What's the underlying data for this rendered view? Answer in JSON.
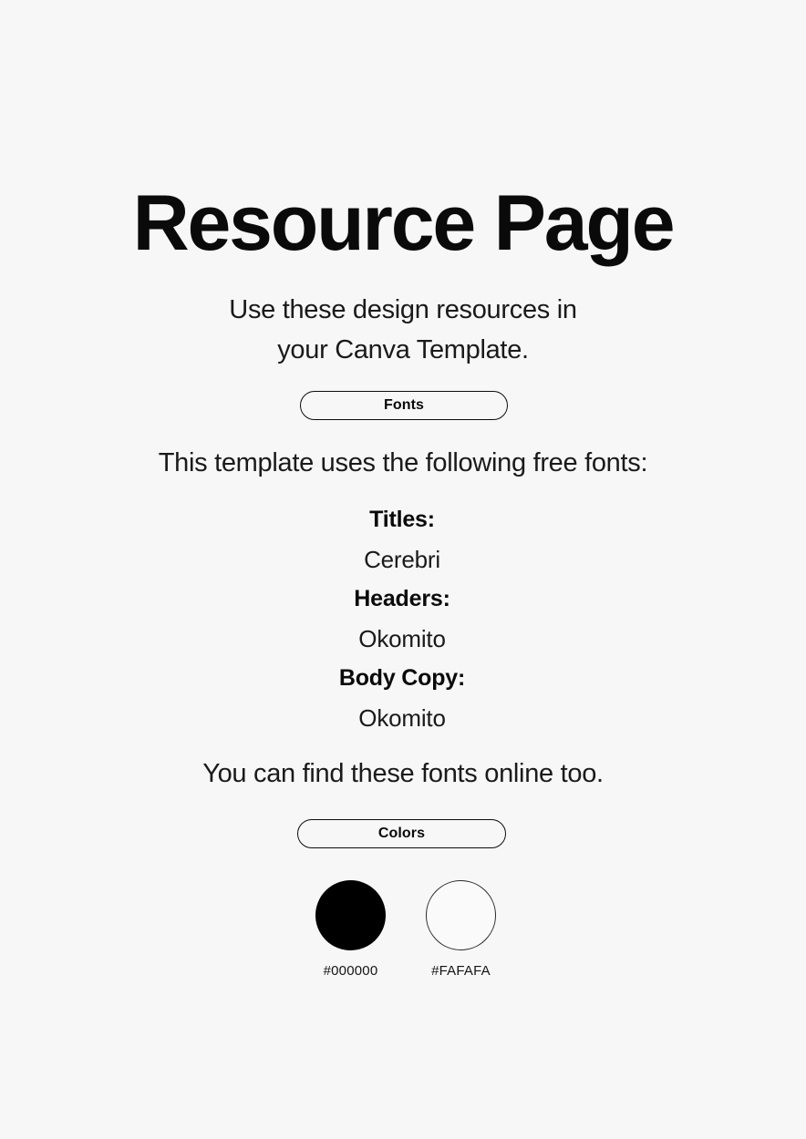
{
  "page": {
    "background_color": "#F7F7F7",
    "title": "Resource Page",
    "subtitle_line_1": "Use these design resources in",
    "subtitle_line_2": "your Canva Template."
  },
  "fonts_section": {
    "badge_label": "Fonts",
    "intro": "This template uses the following free fonts:",
    "rows": [
      {
        "label": "Titles:",
        "value": "Cerebri"
      },
      {
        "label": "Headers:",
        "value": "Okomito"
      },
      {
        "label": "Body Copy:",
        "value": "Okomito"
      }
    ],
    "outro": "You can find these fonts online too."
  },
  "colors_section": {
    "badge_label": "Colors",
    "swatches": [
      {
        "hex": "#000000",
        "fill": "#000000",
        "style": "dark"
      },
      {
        "hex": "#FAFAFA",
        "fill": "#FAFAFA",
        "style": "light"
      }
    ]
  }
}
